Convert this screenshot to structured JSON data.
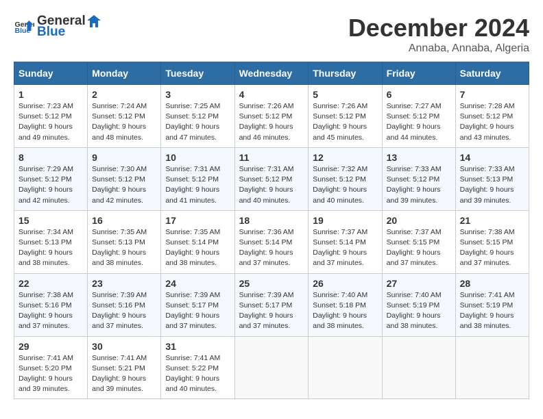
{
  "logo": {
    "general": "General",
    "blue": "Blue"
  },
  "title": "December 2024",
  "location": "Annaba, Annaba, Algeria",
  "days_of_week": [
    "Sunday",
    "Monday",
    "Tuesday",
    "Wednesday",
    "Thursday",
    "Friday",
    "Saturday"
  ],
  "weeks": [
    [
      {
        "day": "1",
        "sunrise": "7:23 AM",
        "sunset": "5:12 PM",
        "daylight": "9 hours and 49 minutes."
      },
      {
        "day": "2",
        "sunrise": "7:24 AM",
        "sunset": "5:12 PM",
        "daylight": "9 hours and 48 minutes."
      },
      {
        "day": "3",
        "sunrise": "7:25 AM",
        "sunset": "5:12 PM",
        "daylight": "9 hours and 47 minutes."
      },
      {
        "day": "4",
        "sunrise": "7:26 AM",
        "sunset": "5:12 PM",
        "daylight": "9 hours and 46 minutes."
      },
      {
        "day": "5",
        "sunrise": "7:26 AM",
        "sunset": "5:12 PM",
        "daylight": "9 hours and 45 minutes."
      },
      {
        "day": "6",
        "sunrise": "7:27 AM",
        "sunset": "5:12 PM",
        "daylight": "9 hours and 44 minutes."
      },
      {
        "day": "7",
        "sunrise": "7:28 AM",
        "sunset": "5:12 PM",
        "daylight": "9 hours and 43 minutes."
      }
    ],
    [
      {
        "day": "8",
        "sunrise": "7:29 AM",
        "sunset": "5:12 PM",
        "daylight": "9 hours and 42 minutes."
      },
      {
        "day": "9",
        "sunrise": "7:30 AM",
        "sunset": "5:12 PM",
        "daylight": "9 hours and 42 minutes."
      },
      {
        "day": "10",
        "sunrise": "7:31 AM",
        "sunset": "5:12 PM",
        "daylight": "9 hours and 41 minutes."
      },
      {
        "day": "11",
        "sunrise": "7:31 AM",
        "sunset": "5:12 PM",
        "daylight": "9 hours and 40 minutes."
      },
      {
        "day": "12",
        "sunrise": "7:32 AM",
        "sunset": "5:12 PM",
        "daylight": "9 hours and 40 minutes."
      },
      {
        "day": "13",
        "sunrise": "7:33 AM",
        "sunset": "5:12 PM",
        "daylight": "9 hours and 39 minutes."
      },
      {
        "day": "14",
        "sunrise": "7:33 AM",
        "sunset": "5:13 PM",
        "daylight": "9 hours and 39 minutes."
      }
    ],
    [
      {
        "day": "15",
        "sunrise": "7:34 AM",
        "sunset": "5:13 PM",
        "daylight": "9 hours and 38 minutes."
      },
      {
        "day": "16",
        "sunrise": "7:35 AM",
        "sunset": "5:13 PM",
        "daylight": "9 hours and 38 minutes."
      },
      {
        "day": "17",
        "sunrise": "7:35 AM",
        "sunset": "5:14 PM",
        "daylight": "9 hours and 38 minutes."
      },
      {
        "day": "18",
        "sunrise": "7:36 AM",
        "sunset": "5:14 PM",
        "daylight": "9 hours and 37 minutes."
      },
      {
        "day": "19",
        "sunrise": "7:37 AM",
        "sunset": "5:14 PM",
        "daylight": "9 hours and 37 minutes."
      },
      {
        "day": "20",
        "sunrise": "7:37 AM",
        "sunset": "5:15 PM",
        "daylight": "9 hours and 37 minutes."
      },
      {
        "day": "21",
        "sunrise": "7:38 AM",
        "sunset": "5:15 PM",
        "daylight": "9 hours and 37 minutes."
      }
    ],
    [
      {
        "day": "22",
        "sunrise": "7:38 AM",
        "sunset": "5:16 PM",
        "daylight": "9 hours and 37 minutes."
      },
      {
        "day": "23",
        "sunrise": "7:39 AM",
        "sunset": "5:16 PM",
        "daylight": "9 hours and 37 minutes."
      },
      {
        "day": "24",
        "sunrise": "7:39 AM",
        "sunset": "5:17 PM",
        "daylight": "9 hours and 37 minutes."
      },
      {
        "day": "25",
        "sunrise": "7:39 AM",
        "sunset": "5:17 PM",
        "daylight": "9 hours and 37 minutes."
      },
      {
        "day": "26",
        "sunrise": "7:40 AM",
        "sunset": "5:18 PM",
        "daylight": "9 hours and 38 minutes."
      },
      {
        "day": "27",
        "sunrise": "7:40 AM",
        "sunset": "5:19 PM",
        "daylight": "9 hours and 38 minutes."
      },
      {
        "day": "28",
        "sunrise": "7:41 AM",
        "sunset": "5:19 PM",
        "daylight": "9 hours and 38 minutes."
      }
    ],
    [
      {
        "day": "29",
        "sunrise": "7:41 AM",
        "sunset": "5:20 PM",
        "daylight": "9 hours and 39 minutes."
      },
      {
        "day": "30",
        "sunrise": "7:41 AM",
        "sunset": "5:21 PM",
        "daylight": "9 hours and 39 minutes."
      },
      {
        "day": "31",
        "sunrise": "7:41 AM",
        "sunset": "5:22 PM",
        "daylight": "9 hours and 40 minutes."
      },
      null,
      null,
      null,
      null
    ]
  ]
}
